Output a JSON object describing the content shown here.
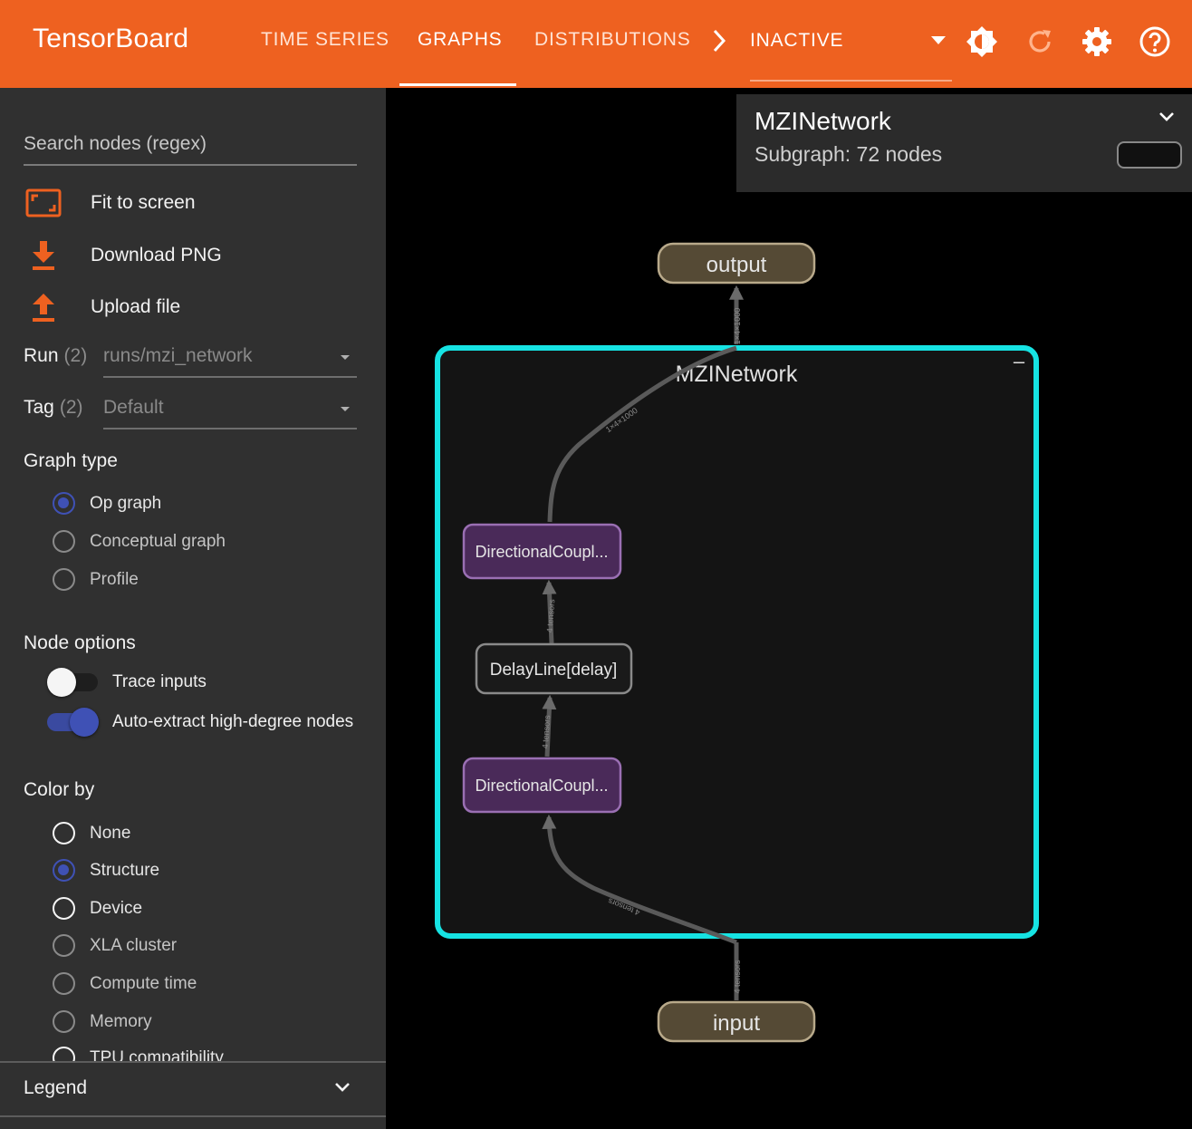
{
  "app": {
    "title": "TensorBoard"
  },
  "nav": {
    "tabs": [
      {
        "label": "TIME SERIES"
      },
      {
        "label": "GRAPHS"
      },
      {
        "label": "DISTRIBUTIONS"
      },
      {
        "label": "INACTIVE"
      }
    ]
  },
  "colors": {
    "brand": "#ee6120",
    "accent": "#3f51b5",
    "cyan": "#16e3e3",
    "node_purple": "#4a2a59",
    "node_tan": "#554a35"
  },
  "sidebar": {
    "search": {
      "placeholder": "Search nodes (regex)"
    },
    "actions": [
      {
        "label": "Fit to screen",
        "icon": "fit-screen-icon"
      },
      {
        "label": "Download PNG",
        "icon": "download-icon"
      },
      {
        "label": "Upload file",
        "icon": "upload-icon"
      }
    ],
    "run": {
      "label": "Run",
      "count": "(2)",
      "value": "runs/mzi_network"
    },
    "tag": {
      "label": "Tag",
      "count": "(2)",
      "value": "Default"
    },
    "graph_type": {
      "title": "Graph type",
      "options": [
        "Op graph",
        "Conceptual graph",
        "Profile"
      ],
      "selected": "Op graph"
    },
    "node_options": {
      "title": "Node options",
      "trace_inputs": {
        "label": "Trace inputs",
        "on": false
      },
      "auto_extract": {
        "label": "Auto-extract high-degree nodes",
        "on": true
      }
    },
    "color_by": {
      "title": "Color by",
      "options": [
        "None",
        "Structure",
        "Device",
        "XLA cluster",
        "Compute time",
        "Memory",
        "TPU compatibility"
      ],
      "selected": "Structure"
    },
    "legend": {
      "label": "Legend"
    }
  },
  "info_card": {
    "title": "MZINetwork",
    "subtitle": "Subgraph: 72 nodes"
  },
  "graph": {
    "group_label": "MZINetwork",
    "collapse_symbol": "–",
    "nodes": {
      "output": "output",
      "input": "input",
      "dc_top": "DirectionalCoupl...",
      "delay": "DelayLine[delay]",
      "dc_bottom": "DirectionalCoupl..."
    },
    "edge_labels": {
      "out_edge": "1×4×1000",
      "group_to_dc": "1×4×1000",
      "delay_to_dc": "4 tensors",
      "dc_to_delay": "4 tensors",
      "in_to_dc": "4 tensors",
      "in_edge": "4 tensors"
    }
  }
}
